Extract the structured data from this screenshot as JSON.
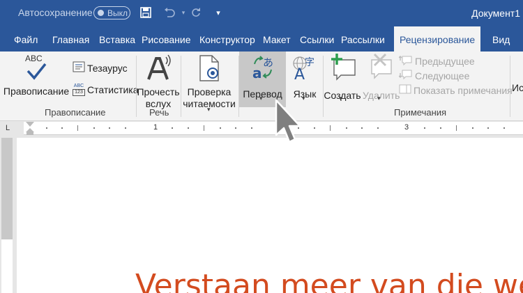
{
  "titlebar": {
    "autosave_label": "Автосохранение",
    "autosave_state": "Выкл",
    "document_title": "Документ1"
  },
  "tabs": [
    {
      "label": "Файл",
      "active": false
    },
    {
      "label": "Главная",
      "active": false
    },
    {
      "label": "Вставка",
      "active": false
    },
    {
      "label": "Рисование",
      "active": false
    },
    {
      "label": "Конструктор",
      "active": false
    },
    {
      "label": "Макет",
      "active": false
    },
    {
      "label": "Ссылки",
      "active": false
    },
    {
      "label": "Рассылки",
      "active": false
    },
    {
      "label": "Рецензирование",
      "active": true
    },
    {
      "label": "Вид",
      "active": false
    }
  ],
  "ribbon": {
    "proofing": {
      "spelling_label": "Правописание",
      "spelling_icon_text": "ABC",
      "thesaurus_label": "Тезаурус",
      "stats_label": "Статистика",
      "stats_icon_text_top": "ABC",
      "stats_icon_text_bottom": "123",
      "group_label": "Правописание"
    },
    "speech": {
      "read_aloud_label_1": "Прочесть",
      "read_aloud_label_2": "вслух",
      "group_label": "Речь"
    },
    "accessibility": {
      "check_label_1": "Проверка",
      "check_label_2": "читаемости"
    },
    "language": {
      "translate_label": "Перевод",
      "language_label": "Язык"
    },
    "comments": {
      "new_label": "Создать",
      "delete_label": "Удалить",
      "previous_label": "Предыдущее",
      "next_label": "Следующее",
      "show_label": "Показать примечания",
      "group_label": "Примечания"
    },
    "cut_off_label": "Ис"
  },
  "ruler": {
    "numbers": [
      "1",
      "2",
      "3"
    ]
  },
  "document": {
    "visible_text": "Verstaan meer van die wê"
  },
  "colors": {
    "accent": "#2b579a",
    "document_text": "#d34b1f"
  }
}
